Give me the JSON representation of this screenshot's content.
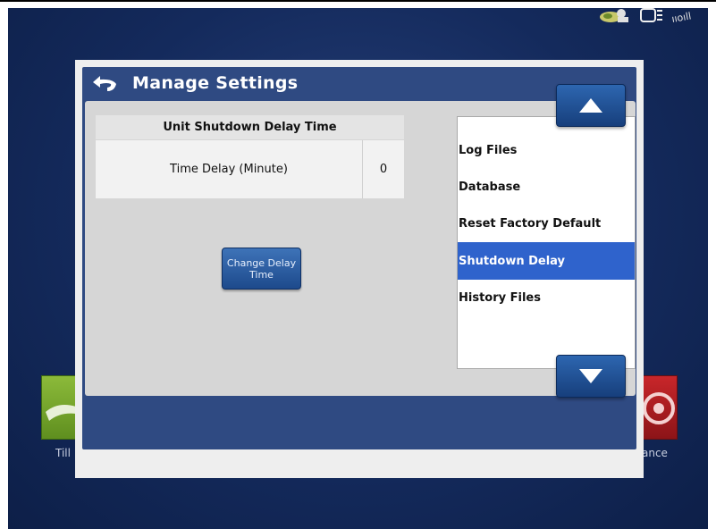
{
  "dialog": {
    "title": "Manage Settings"
  },
  "table": {
    "header": "Unit Shutdown Delay Time",
    "rows": [
      {
        "label": "Time Delay (Minute)",
        "value": "0"
      }
    ]
  },
  "change_button_label": "Change Delay Time",
  "list": {
    "items": [
      {
        "label": "Log Files",
        "selected": false
      },
      {
        "label": "Database",
        "selected": false
      },
      {
        "label": "Reset Factory Default",
        "selected": false
      },
      {
        "label": "Shutdown Delay",
        "selected": true
      },
      {
        "label": "History Files",
        "selected": false
      }
    ]
  },
  "background": {
    "left_tile_label": "Till",
    "right_tile_label": "ance"
  },
  "colors": {
    "accent": "#2f63cc",
    "header": "#2f4a82",
    "button": "#1d4a8c"
  },
  "icons": {
    "back": "back-arrow-icon",
    "up": "arrow-up-icon",
    "down": "arrow-down-icon",
    "gps": "gps-status-icon",
    "display": "display-status-icon",
    "wireless": "wireless-signal-icon"
  }
}
